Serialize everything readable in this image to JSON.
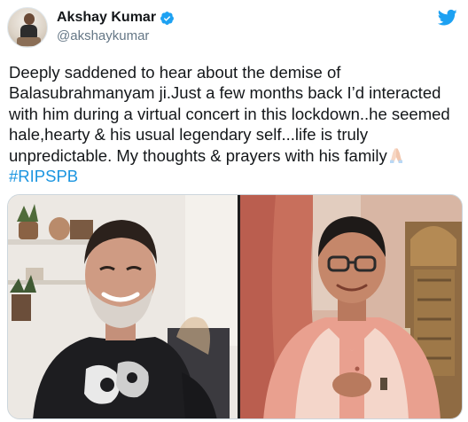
{
  "tweet": {
    "display_name": "Akshay Kumar",
    "handle": "@akshaykumar",
    "verified": true,
    "text_lines": [
      "Deeply saddened to hear about the demise of",
      "Balasubrahmanyam ji.Just a few months back I’d interacted",
      "with him during a virtual concert in this lockdown..he seemed",
      "hale,hearty & his usual legendary self...life is truly",
      "unpredictable. My thoughts & prayers with his family"
    ],
    "hashtag": "#RIPSPB"
  },
  "icons": {
    "verified": "verified-badge-icon",
    "brand": "twitter-bird-icon",
    "emoji": "folded-hands-emoji"
  },
  "colors": {
    "text": "#14171a",
    "secondary": "#657786",
    "link": "#1b95e0",
    "twitter_blue": "#1da1f2"
  }
}
